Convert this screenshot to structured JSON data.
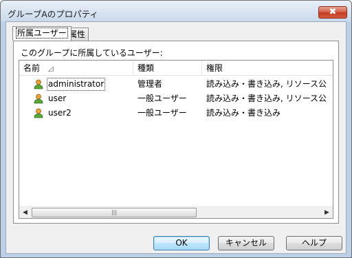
{
  "window": {
    "title": "グループAのプロパティ",
    "close_glyph": "✖"
  },
  "tabs": [
    {
      "label": "所属ユーザー",
      "active": true
    },
    {
      "label": "属性",
      "active": false
    }
  ],
  "panel": {
    "description": "このグループに所属しているユーザー:"
  },
  "list": {
    "columns": [
      "名前",
      "種類",
      "権限"
    ],
    "sort_glyph": "◿",
    "rows": [
      {
        "name": "administrator",
        "type": "管理者",
        "permission": "読み込み・書き込み, リソース公",
        "icon": "user-icon"
      },
      {
        "name": "user",
        "type": "一般ユーザー",
        "permission": "読み込み・書き込み, リソース公",
        "icon": "user-icon"
      },
      {
        "name": "user2",
        "type": "一般ユーザー",
        "permission": "読み込み・書き込み",
        "icon": "user-icon"
      }
    ],
    "scroll_left": "◀",
    "scroll_right": "▶",
    "thumb_grip": "|||"
  },
  "buttons": {
    "ok": "OK",
    "cancel": "キャンセル",
    "help": "ヘルプ"
  }
}
